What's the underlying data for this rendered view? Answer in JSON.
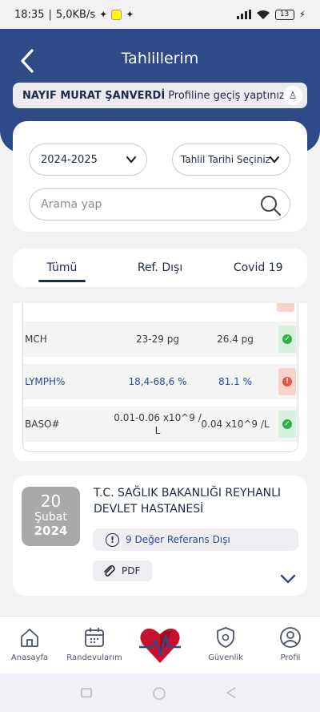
{
  "status_bar": {
    "time": "18:35",
    "speed": "5,0KB/s",
    "battery": "13"
  },
  "header": {
    "title": "Tahlillerim"
  },
  "profile_banner": {
    "name": "NAYIF MURAT ŞANVERDİ",
    "message": "Profiline geçiş yaptınız."
  },
  "filters": {
    "year": "2024-2025",
    "date": "Tahlil Tarihi Seçiniz",
    "search_placeholder": "Arama yap"
  },
  "tabs": [
    {
      "label": "Tümü",
      "active": true
    },
    {
      "label": "Ref. Dışı",
      "active": false
    },
    {
      "label": "Covid 19",
      "active": false
    }
  ],
  "results": [
    {
      "name": "MCH",
      "range": "23-29 pg",
      "value": "26.4 pg",
      "status": "ok"
    },
    {
      "name": "LYMPH%",
      "range": "18,4-68,6 %",
      "value": "81.1 %",
      "status": "out"
    },
    {
      "name": "BASO#",
      "range": "0.01-0.06 x10^9 / L",
      "value": "0.04 x10^9 /L",
      "status": "ok"
    }
  ],
  "report": {
    "day": "20",
    "month": "Şubat",
    "year": "2024",
    "hospital": "T.C. SAĞLIK BAKANLIĞI REYHANLI DEVLET HASTANESİ",
    "alert": "9 Değer Referans Dışı",
    "pdf_label": "PDF"
  },
  "bottom_nav": [
    {
      "label": "Anasayfa",
      "icon": "home-icon"
    },
    {
      "label": "Randevularım",
      "icon": "calendar-icon"
    },
    {
      "label": "",
      "icon": "heart-logo"
    },
    {
      "label": "Güvenlik",
      "icon": "shield-icon"
    },
    {
      "label": "Profil",
      "icon": "user-icon"
    }
  ],
  "colors": {
    "primary": "#2e4a87",
    "ok": "#2fae4a",
    "out": "#e4573d"
  }
}
